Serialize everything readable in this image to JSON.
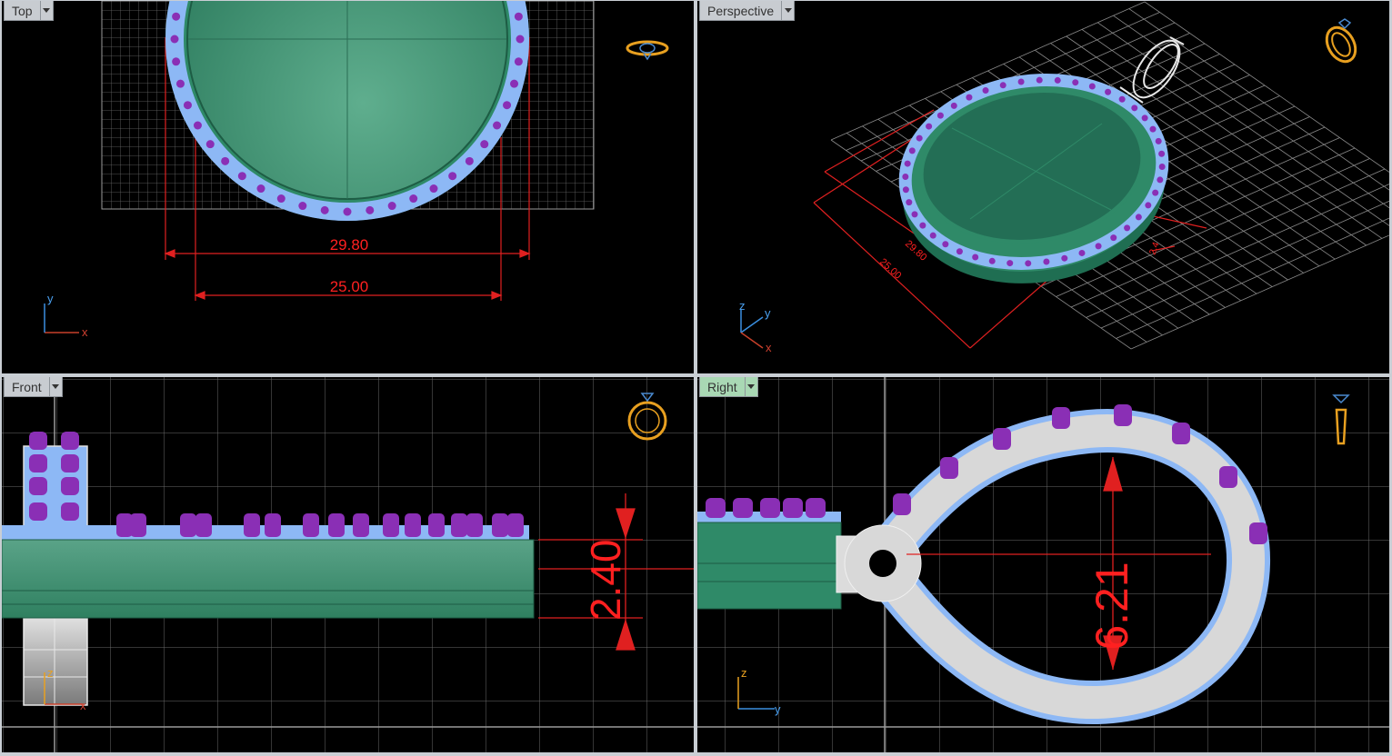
{
  "viewports": {
    "top": {
      "label": "Top"
    },
    "perspective": {
      "label": "Perspective"
    },
    "front": {
      "label": "Front"
    },
    "right": {
      "label": "Right"
    }
  },
  "dimensions": {
    "top_outer": "29.80",
    "top_inner": "25.00",
    "persp_outer": "29.80",
    "persp_inner": "25.00",
    "persp_height": "2.4",
    "front_height": "2.40",
    "right_height": "6.21"
  },
  "axes": {
    "x": "x",
    "y": "y",
    "z": "z"
  },
  "icons": [
    "viewport-menu-caret-icon",
    "top-view-widget-icon",
    "perspective-view-widget-icon",
    "front-view-widget-icon",
    "right-view-widget-icon"
  ],
  "colors": {
    "background": "#000000",
    "grid": "#6e6e6e",
    "metal_green": "#2f8a68",
    "setting_blue": "#8db8f5",
    "gem_purple": "#8a2fb5",
    "dimension_red": "#ff2020",
    "bail_white": "#d8d8d8",
    "active_tab": "#a9d8b4",
    "widget_orange": "#e8a020"
  }
}
